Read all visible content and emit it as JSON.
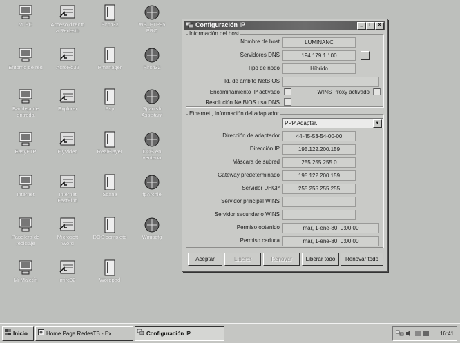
{
  "desktop": {
    "icons": [
      {
        "label": "Mi PC",
        "name": "my-computer-icon"
      },
      {
        "label": "Acceso directo\na Redestb",
        "name": "shortcut-redestb-icon"
      },
      {
        "label": "Pirch32",
        "name": "pirch32-icon"
      },
      {
        "label": "WS_FTP95\nPRO",
        "name": "ws-ftp95-pro-icon"
      },
      {
        "label": "Entorno de red",
        "name": "network-neighborhood-icon"
      },
      {
        "label": "AcroRd32",
        "name": "acrord32-icon"
      },
      {
        "label": "Pmanager",
        "name": "pmanager-icon"
      },
      {
        "label": "Pirch32",
        "name": "pirch32-second-icon"
      },
      {
        "label": "Bandeja de\nentrada",
        "name": "inbox-icon"
      },
      {
        "label": "Explorer",
        "name": "explorer-icon"
      },
      {
        "label": "Psp",
        "name": "psp-icon"
      },
      {
        "label": "Spanish\nAssistant",
        "name": "spanish-assistant-icon"
      },
      {
        "label": "EasyFTP",
        "name": "easyftp-icon"
      },
      {
        "label": "FlyVideo",
        "name": "flyvideo-icon"
      },
      {
        "label": "RealPlayer",
        "name": "realplayer-icon"
      },
      {
        "label": "DOS en\nventana",
        "name": "dos-window-icon"
      },
      {
        "label": "Internet",
        "name": "internet-icon"
      },
      {
        "label": "Internet\nFastFind",
        "name": "internet-fastfind-icon"
      },
      {
        "label": "Scana",
        "name": "scana-icon"
      },
      {
        "label": "fpArchie",
        "name": "fparchie-icon"
      },
      {
        "label": "Papelera de\nreciclaje",
        "name": "recycle-bin-icon"
      },
      {
        "label": "Microsoft\nWord",
        "name": "microsoft-word-icon"
      },
      {
        "label": "DOS completo",
        "name": "dos-full-icon"
      },
      {
        "label": "Winipcfg",
        "name": "winipcfg-icon"
      },
      {
        "label": "Mi Maletín",
        "name": "my-briefcase-icon"
      },
      {
        "label": "mirc32",
        "name": "mirc32-icon"
      },
      {
        "label": "Wordpad",
        "name": "wordpad-icon"
      }
    ]
  },
  "dialog": {
    "title": "Configuración IP",
    "host_group": "Información del host",
    "host_name_label": "Nombre de host",
    "host_name": "LUMINANC",
    "dns_label": "Servidores DNS",
    "dns_value": "194.179.1.100",
    "node_type_label": "Tipo de nodo",
    "node_type": "Híbrido",
    "netbios_scope_label": "Id. de ámbito NetBIOS",
    "netbios_scope": "",
    "ip_routing_label": "Encaminamiento IP activado",
    "wins_proxy_label": "WINS Proxy activado",
    "netbios_dns_label": "Resolución NetBIOS usa DNS",
    "adapter_group": "Ethernet , Información del adaptador",
    "adapter_selected": "PPP Adapter.",
    "adapter_address_label": "Dirección de adaptador",
    "adapter_address": "44-45-53-54-00-00",
    "ip_address_label": "Dirección IP",
    "ip_address": "195.122.200.159",
    "subnet_label": "Máscara de subred",
    "subnet": "255.255.255.0",
    "gateway_label": "Gateway predeterminado",
    "gateway": "195.122.200.159",
    "dhcp_label": "Servidor DHCP",
    "dhcp": "255.255.255.255",
    "wins_primary_label": "Servidor principal WINS",
    "wins_primary": "",
    "wins_secondary_label": "Servidor secundario WINS",
    "wins_secondary": "",
    "lease_obtained_label": "Permiso obtenido",
    "lease_obtained": "mar, 1-ene-80, 0:00:00",
    "lease_expires_label": "Permiso caduca",
    "lease_expires": "mar, 1-ene-80, 0:00:00",
    "buttons": {
      "accept": "Aceptar",
      "release": "Liberar",
      "renew": "Renovar",
      "release_all": "Liberar todo",
      "renew_all": "Renovar todo"
    }
  },
  "taskbar": {
    "start": "Inicio",
    "task1": "Home Page RedesTB - Ex...",
    "task2": "Configuración IP",
    "clock": "16:41"
  }
}
